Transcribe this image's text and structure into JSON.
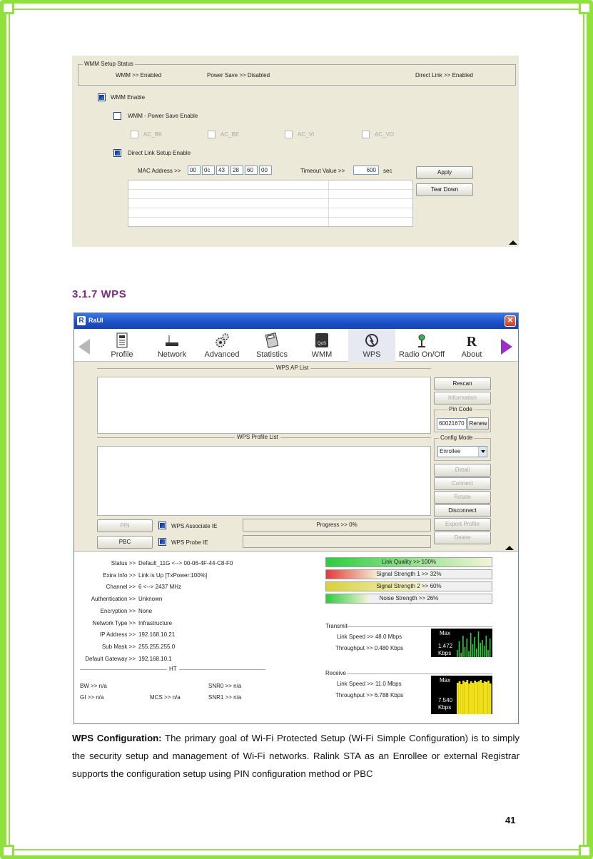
{
  "wmm": {
    "group_title": "WMM Setup Status",
    "status_wmm": "WMM >> Enabled",
    "status_ps": "Power Save >> Disabled",
    "status_dl": "Direct Link >> Enabled",
    "wmm_enable": "WMM Enable",
    "ps_enable": "WMM - Power Save Enable",
    "ac": [
      "AC_BK",
      "AC_BE",
      "AC_VI",
      "AC_VO"
    ],
    "dls_enable": "Direct Link Setup Enable",
    "mac_label": "MAC Address >>",
    "mac": [
      "00",
      "0c",
      "43",
      "28",
      "60",
      "00"
    ],
    "timeout_label": "Timeout Value >>",
    "timeout_value": "600",
    "timeout_unit": "sec",
    "apply": "Apply",
    "teardown": "Tear Down"
  },
  "heading": "3.1.7   WPS",
  "window": {
    "title": "RaUI",
    "logo": "R",
    "close": "✕",
    "tabs": [
      "Profile",
      "Network",
      "Advanced",
      "Statistics",
      "WMM",
      "WPS",
      "Radio On/Off",
      "About"
    ],
    "ap_list_title": "WPS AP List",
    "profile_list_title": "WPS Profile List",
    "rescan": "Rescan",
    "information": "Information",
    "pin_code_legend": "Pin Code",
    "pin_code": "60021670",
    "renew": "Renew",
    "config_mode_legend": "Config Mode",
    "config_mode": "Enrollee",
    "detail": "Detail",
    "connect": "Connect",
    "rotate": "Rotate",
    "disconnect": "Disconnect",
    "export_profile": "Export Profile",
    "delete": "Delete",
    "pin": "PIN",
    "pbc": "PBC",
    "assoc_ie": "WPS Associate IE",
    "probe_ie": "WPS Probe IE",
    "progress": "Progress >> 0%"
  },
  "status": {
    "rows": [
      {
        "k": "Status >>",
        "v": "Default_11G <--> 00-06-4F-44-C8-F0"
      },
      {
        "k": "Extra Info >>",
        "v": "Link is Up [TxPower:100%]"
      },
      {
        "k": "Channel >>",
        "v": "6 <--> 2437 MHz"
      },
      {
        "k": "Authentication >>",
        "v": "Unknown"
      },
      {
        "k": "Encryption >>",
        "v": "None"
      },
      {
        "k": "Network Type >>",
        "v": "Infrastructure"
      },
      {
        "k": "IP Address >>",
        "v": "192.168.10.21"
      },
      {
        "k": "Sub Mask >>",
        "v": "255.255.255.0"
      },
      {
        "k": "Default Gateway >>",
        "v": "192.168.10.1"
      }
    ],
    "ht_title": "HT",
    "bw": "BW >> n/a",
    "gi": "GI >> n/a",
    "mcs": "MCS >> n/a",
    "snr0": "SNR0 >> n/a",
    "snr1": "SNR1 >> n/a",
    "bars": [
      {
        "label": "Link Quality >> 100%",
        "value": 100,
        "color": "#2ecc40"
      },
      {
        "label": "Signal Strength 1 >> 32%",
        "value": 32,
        "color": "#e23a3a"
      },
      {
        "label": "Signal Strength 2 >> 60%",
        "value": 60,
        "color": "#d8d23a"
      },
      {
        "label": "Noise Strength >> 26%",
        "value": 26,
        "color": "#2ecc40"
      }
    ],
    "transmit_title": "Transmit",
    "tx_link": "Link Speed >> 48.0 Mbps",
    "tx_thr": "Throughput >> 0.480 Kbps",
    "tx_graph_max": "Max",
    "tx_graph_val": "1.472",
    "tx_graph_unit": "Kbps",
    "receive_title": "Receive",
    "rx_link": "Link Speed >> 11.0 Mbps",
    "rx_thr": "Throughput >> 6.788 Kbps",
    "rx_graph_max": "Max",
    "rx_graph_val": "7.540",
    "rx_graph_unit": "Kbps"
  },
  "paragraph": {
    "lead": "WPS Configuration:",
    "text": " The primary goal of Wi-Fi Protected Setup (Wi-Fi Simple Configuration) is to simply the security setup and management of Wi-Fi networks. Ralink STA as an Enrollee or external Registrar supports the configuration setup using PIN configuration method or PBC"
  },
  "page_number": "41"
}
